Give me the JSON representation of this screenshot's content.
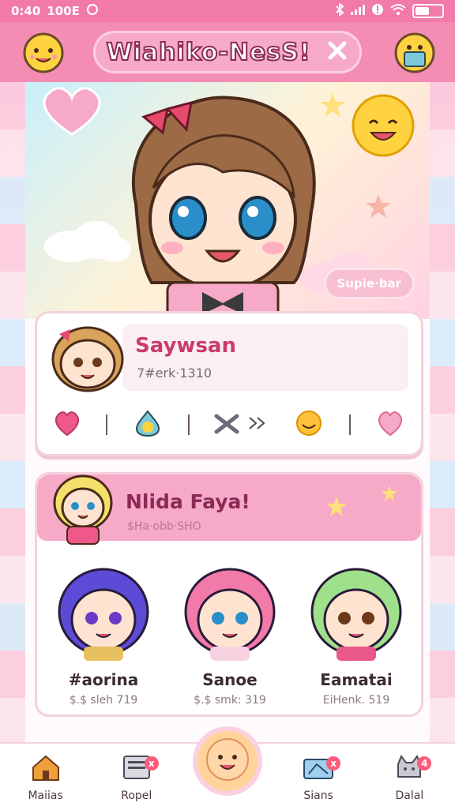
{
  "status_bar": {
    "time": "0:40",
    "left_extra": "100E",
    "battery_level": 0.6
  },
  "header": {
    "title": "Wiahiko-NesS!",
    "close_icon": "close-x-icon"
  },
  "hero": {
    "tag_text": "Supie·bar"
  },
  "profile": {
    "name": "Saywsan",
    "meta": "7#erk·1310",
    "actions": [
      "heart-icon",
      "drop-face-icon",
      "shuffle-icon",
      "sun-face-icon",
      "heart-outline-icon"
    ]
  },
  "group": {
    "title": "Nlida Faya!",
    "meta": "$Ha·obb·SHO",
    "friends": [
      {
        "name": "#aorina",
        "meta": "$.$ sleh 719",
        "hair": "#5b4bd6",
        "accent": "#f5a9c8"
      },
      {
        "name": "Sanoe",
        "meta": "$.$ smk: 319",
        "hair": "#f27aa8",
        "accent": "#f7d3e2"
      },
      {
        "name": "Eamatai",
        "meta": "EiHenk. 519",
        "hair": "#9fe08a",
        "accent": "#f7d3e2"
      }
    ]
  },
  "nav": {
    "items": [
      {
        "label": "Maiias",
        "icon": "home-icon",
        "badge": ""
      },
      {
        "label": "Ropel",
        "icon": "tablet-icon",
        "badge": "x"
      },
      {
        "label": "Sians",
        "icon": "box-icon",
        "badge": "x"
      },
      {
        "label": "Dalal",
        "icon": "cat-icon",
        "badge": "4"
      }
    ]
  },
  "colors": {
    "accent": "#f48db4",
    "title_outline": "#8a2a55",
    "card_border": "#f3d2dc"
  }
}
